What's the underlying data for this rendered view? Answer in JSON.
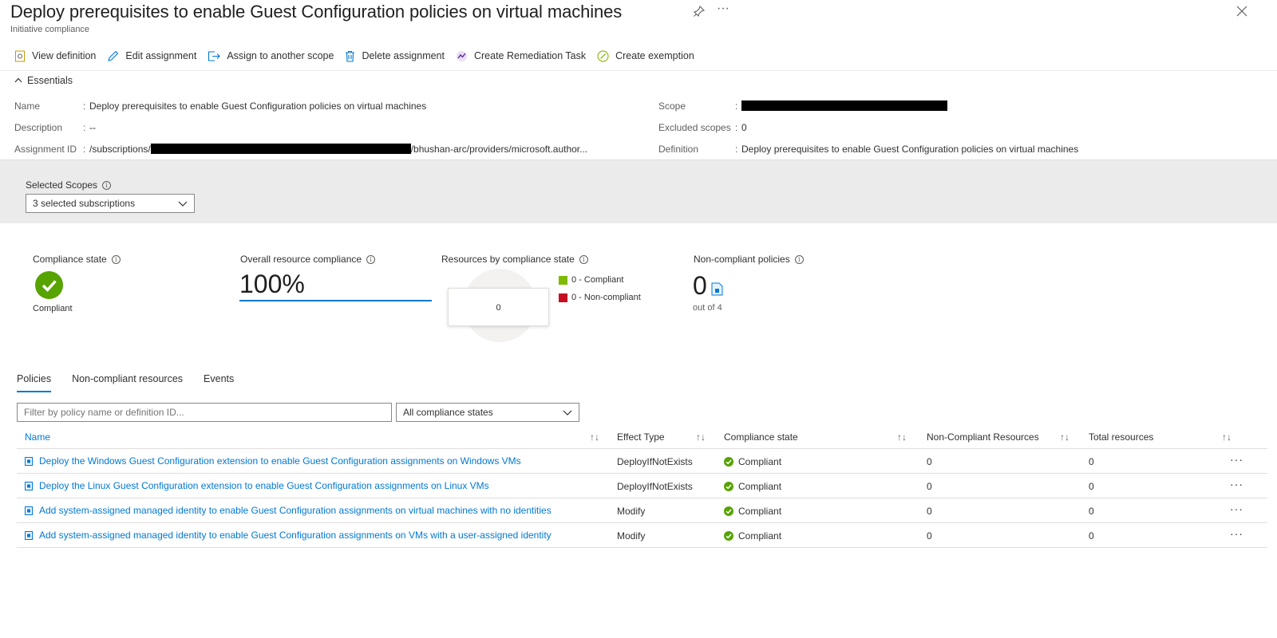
{
  "header": {
    "title": "Deploy prerequisites to enable Guest Configuration policies on virtual machines",
    "subtitle": "Initiative compliance",
    "more": "···"
  },
  "toolbar": {
    "view_definition": "View definition",
    "edit_assignment": "Edit assignment",
    "assign_scope": "Assign to another scope",
    "delete_assignment": "Delete assignment",
    "remediation": "Create Remediation Task",
    "exemption": "Create exemption"
  },
  "essentials": {
    "toggle_label": "Essentials",
    "name_label": "Name",
    "name_value": "Deploy prerequisites to enable Guest Configuration policies on virtual machines",
    "description_label": "Description",
    "description_value": "--",
    "assignment_id_label": "Assignment ID",
    "assignment_id_prefix": "/subscriptions/",
    "assignment_id_suffix": "/bhushan-arc/providers/microsoft.author...",
    "scope_label": "Scope",
    "excluded_label": "Excluded scopes",
    "excluded_value": "0",
    "definition_label": "Definition",
    "definition_value": "Deploy prerequisites to enable Guest Configuration policies on virtual machines",
    "separator": ":"
  },
  "scopes": {
    "label": "Selected Scopes",
    "value": "3 selected subscriptions"
  },
  "metrics": {
    "compliance_state_label": "Compliance state",
    "compliance_state_value": "Compliant",
    "overall_label": "Overall resource compliance",
    "overall_value": "100%",
    "by_state_label": "Resources by compliance state",
    "donut_center": "0",
    "legend_compliant": "0 - Compliant",
    "legend_noncompliant": "0 - Non-compliant",
    "noncompliant_policies_label": "Non-compliant policies",
    "noncompliant_policies_value": "0",
    "out_of": "out of 4"
  },
  "colors": {
    "accent": "#0078d4",
    "compliant": "#57a300",
    "noncompliant": "#c50f1f"
  },
  "tabs": [
    "Policies",
    "Non-compliant resources",
    "Events"
  ],
  "filter": {
    "placeholder": "Filter by policy name or definition ID...",
    "state_value": "All compliance states"
  },
  "table": {
    "columns": [
      "Name",
      "Effect Type",
      "Compliance state",
      "Non-Compliant Resources",
      "Total resources"
    ],
    "sort_glyph": "↑↓",
    "more_glyph": "···",
    "rows": [
      {
        "name": "Deploy the Windows Guest Configuration extension to enable Guest Configuration assignments on Windows VMs",
        "effect": "DeployIfNotExists",
        "state": "Compliant",
        "noncompliant": "0",
        "total": "0"
      },
      {
        "name": "Deploy the Linux Guest Configuration extension to enable Guest Configuration assignments on Linux VMs",
        "effect": "DeployIfNotExists",
        "state": "Compliant",
        "noncompliant": "0",
        "total": "0"
      },
      {
        "name": "Add system-assigned managed identity to enable Guest Configuration assignments on virtual machines with no identities",
        "effect": "Modify",
        "state": "Compliant",
        "noncompliant": "0",
        "total": "0"
      },
      {
        "name": "Add system-assigned managed identity to enable Guest Configuration assignments on VMs with a user-assigned identity",
        "effect": "Modify",
        "state": "Compliant",
        "noncompliant": "0",
        "total": "0"
      }
    ]
  }
}
